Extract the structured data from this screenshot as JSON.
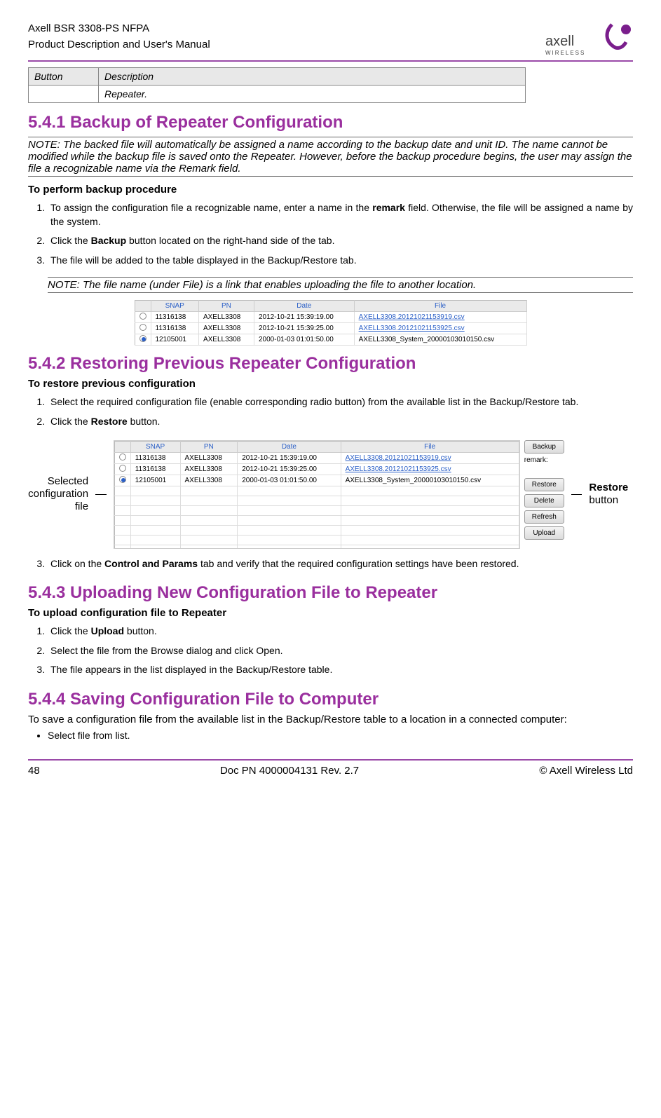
{
  "header": {
    "line1": "Axell BSR 3308-PS NFPA",
    "line2": "Product Description and User's Manual",
    "logo_brand": "axell",
    "logo_sub": "WIRELESS"
  },
  "desc_table": {
    "h1": "Button",
    "h2": "Description",
    "v2": "Repeater."
  },
  "sections": {
    "s1_title": "5.4.1   Backup of Repeater Configuration",
    "s1_note": "NOTE: The backed file will automatically be assigned a name according to the backup date and unit ID. The name cannot be modified while the backup file is saved onto the Repeater. However, before the backup procedure begins, the user may assign the file a recognizable name via the Remark field.",
    "s1_heading": "To perform backup procedure",
    "s1_li1a": "To assign the configuration file a recognizable name, enter a name in the ",
    "s1_li1b": "remark",
    "s1_li1c": " field. Otherwise, the file will be assigned a name by the system.",
    "s1_li2a": "Click the ",
    "s1_li2b": "Backup",
    "s1_li2c": " button located on the right-hand side of the tab.",
    "s1_li3": "The file will be added to the table displayed in the Backup/Restore tab.",
    "s1_note2": "NOTE: The file name (under File) is a link that enables uploading the file to another location.",
    "s2_title": "5.4.2   Restoring Previous Repeater Configuration",
    "s2_heading": "To restore previous configuration",
    "s2_li1": "Select the required configuration file (enable corresponding radio button) from the available list in the Backup/Restore tab.",
    "s2_li2a": "Click the ",
    "s2_li2b": "Restore",
    "s2_li2c": " button.",
    "s2_li3a": "Click on the ",
    "s2_li3b": "Control and Params",
    "s2_li3c": " tab and verify that the required configuration settings have been restored.",
    "s3_title": "5.4.3   Uploading New Configuration File to Repeater",
    "s3_heading": "To upload configuration file to Repeater",
    "s3_li1a": "Click the ",
    "s3_li1b": "Upload",
    "s3_li1c": " button.",
    "s3_li2": "Select the file from the Browse dialog and click Open.",
    "s3_li3": "The file appears in the list displayed in the Backup/Restore table.",
    "s4_title": "5.4.4   Saving Configuration File to Computer",
    "s4_para": "To save a configuration file from the available list in the Backup/Restore table to a location in a connected computer:",
    "s4_b1": "Select file from list."
  },
  "annot": {
    "left1": "Selected",
    "left2": "configuration",
    "left3": "file",
    "right1": "Restore",
    "right2": "button"
  },
  "screenshot": {
    "headers": [
      "SNAP",
      "PN",
      "Date",
      "File"
    ],
    "rows": [
      {
        "sel": false,
        "snap": "11316138",
        "pn": "AXELL3308",
        "date": "2012-10-21 15:39:19.00",
        "file": "AXELL3308.20121021153919.csv",
        "link": true
      },
      {
        "sel": false,
        "snap": "11316138",
        "pn": "AXELL3308",
        "date": "2012-10-21 15:39:25.00",
        "file": "AXELL3308.20121021153925.csv",
        "link": true
      },
      {
        "sel": true,
        "snap": "12105001",
        "pn": "AXELL3308",
        "date": "2000-01-03 01:01:50.00",
        "file": "AXELL3308_System_20000103010150.csv",
        "link": false
      }
    ],
    "buttons": {
      "backup": "Backup",
      "remark": "remark:",
      "restore": "Restore",
      "delete": "Delete",
      "refresh": "Refresh",
      "upload": "Upload"
    }
  },
  "footer": {
    "page": "48",
    "docid": "Doc PN 4000004131 Rev. 2.7",
    "copyright": "© Axell Wireless Ltd"
  }
}
